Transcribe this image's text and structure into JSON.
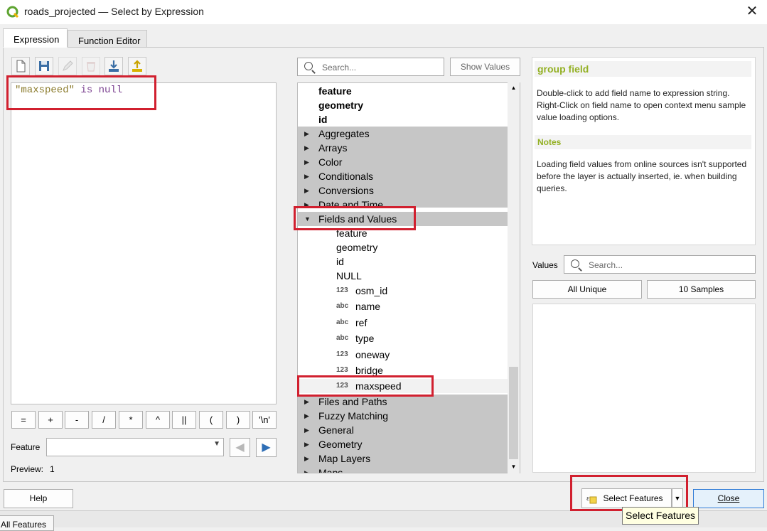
{
  "window": {
    "title": "roads_projected — Select by Expression",
    "close_glyph": "✕"
  },
  "tabs": [
    "Expression",
    "Function Editor"
  ],
  "editor": {
    "expr_field": "\"maxspeed\"",
    "expr_rest": " is null"
  },
  "operators": [
    "=",
    "+",
    "-",
    "/",
    "*",
    "^",
    "||",
    "(",
    ")",
    "'\\n'"
  ],
  "feature": {
    "label": "Feature",
    "value": ""
  },
  "preview": {
    "label": "Preview:",
    "value": "1"
  },
  "function_search": {
    "placeholder": "Search...",
    "show_values": "Show Values"
  },
  "tree": {
    "top_items": [
      "feature",
      "geometry",
      "id"
    ],
    "groups_before": [
      "Aggregates",
      "Arrays",
      "Color",
      "Conditionals",
      "Conversions",
      "Date and Time"
    ],
    "expanded_group": "Fields and Values",
    "fields_plain": [
      "feature",
      "geometry",
      "id",
      "NULL"
    ],
    "fields_typed": [
      {
        "type": "123",
        "name": "osm_id"
      },
      {
        "type": "abc",
        "name": "name"
      },
      {
        "type": "abc",
        "name": "ref"
      },
      {
        "type": "abc",
        "name": "type"
      },
      {
        "type": "123",
        "name": "oneway"
      },
      {
        "type": "123",
        "name": "bridge"
      },
      {
        "type": "123",
        "name": "maxspeed"
      }
    ],
    "groups_after": [
      "Files and Paths",
      "Fuzzy Matching",
      "General",
      "Geometry",
      "Map Layers",
      "Maps"
    ]
  },
  "help": {
    "heading": "group field",
    "text": "Double-click to add field name to expression string. Right-Click on field name to open context menu sample value loading options.",
    "notes_heading": "Notes",
    "notes_text": "Loading field values from online sources isn't supported before the layer is actually inserted, ie. when building queries."
  },
  "values": {
    "label": "Values",
    "placeholder": "Search...",
    "all_unique": "All Unique",
    "samples": "10 Samples"
  },
  "buttons": {
    "help": "Help",
    "select_features": "Select Features",
    "close": "Close"
  },
  "tooltip": "Select Features",
  "background_tab": "All Features",
  "colors": {
    "highlight": "#d1202f",
    "help_heading": "#93b023",
    "group_row": "#c6c6c6"
  }
}
